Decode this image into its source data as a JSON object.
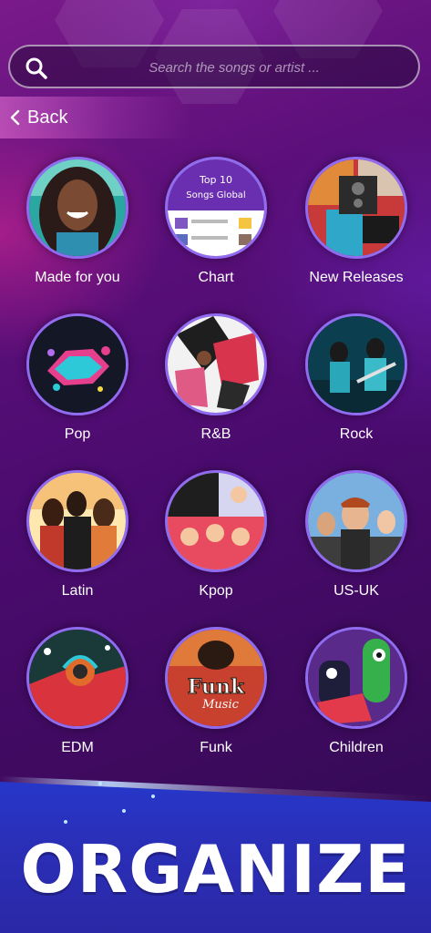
{
  "search": {
    "placeholder": "Search the songs or artist ...",
    "icon": "search-icon"
  },
  "nav": {
    "back_label": "Back",
    "back_icon": "chevron-left-icon"
  },
  "categories": [
    {
      "label": "Made for you",
      "art": "portrait-woman"
    },
    {
      "label": "Chart",
      "art": "top-10-chart-card",
      "art_text": [
        "Top 10",
        "Songs Global"
      ]
    },
    {
      "label": "New Releases",
      "art": "speaker-collage"
    },
    {
      "label": "Pop",
      "art": "pop-music-logo"
    },
    {
      "label": "R&B",
      "art": "rnb-dancers"
    },
    {
      "label": "Rock",
      "art": "rock-band-stage"
    },
    {
      "label": "Latin",
      "art": "latin-group-photo"
    },
    {
      "label": "Kpop",
      "art": "kpop-group-collage"
    },
    {
      "label": "US-UK",
      "art": "us-uk-artists"
    },
    {
      "label": "EDM",
      "art": "edm-headphones"
    },
    {
      "label": "Funk",
      "art": "funk-music-logo",
      "art_text": [
        "Funk",
        "Music"
      ]
    },
    {
      "label": "Children",
      "art": "cartoon-monsters"
    }
  ],
  "banner": {
    "headline": "ORGANIZE"
  },
  "colors": {
    "background": "#4a0b6e",
    "disc_ring": "#8f6cf0",
    "banner": "#2637c9",
    "accent_pink": "#e23aa0"
  }
}
